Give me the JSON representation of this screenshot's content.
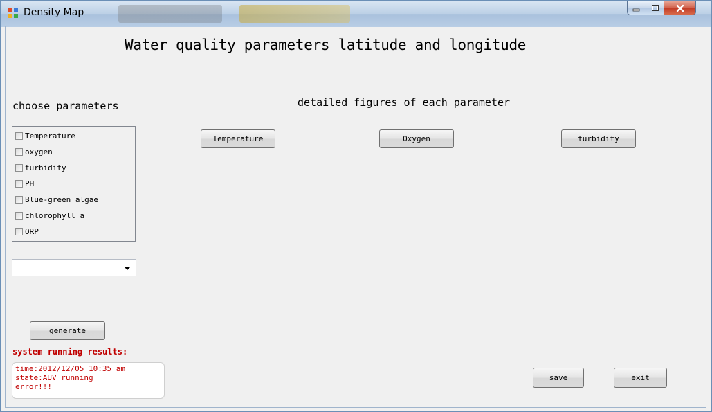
{
  "window": {
    "title": "Density Map"
  },
  "main": {
    "title": "Water quality parameters latitude and longitude",
    "choose_label": "choose parameters",
    "detailed_label": "detailed figures of each parameter"
  },
  "parameters": [
    {
      "label": "Temperature",
      "checked": false
    },
    {
      "label": "oxygen",
      "checked": false
    },
    {
      "label": "turbidity",
      "checked": false
    },
    {
      "label": "PH",
      "checked": false
    },
    {
      "label": "Blue-green algae",
      "checked": false
    },
    {
      "label": "chlorophyll a",
      "checked": false
    },
    {
      "label": "ORP",
      "checked": false
    }
  ],
  "combo": {
    "value": ""
  },
  "buttons": {
    "temperature": "Temperature",
    "oxygen": "Oxygen",
    "turbidity": "turbidity",
    "generate": "generate",
    "save": "save",
    "exit": "exit"
  },
  "results": {
    "title": "system running results:",
    "lines": [
      "time:2012/12/05  10:35 am",
      "state:AUV running",
      "error!!!"
    ]
  },
  "colors": {
    "result_text": "#c00000",
    "titlebar": "#bcd0e6",
    "close_button": "#c13a25"
  }
}
